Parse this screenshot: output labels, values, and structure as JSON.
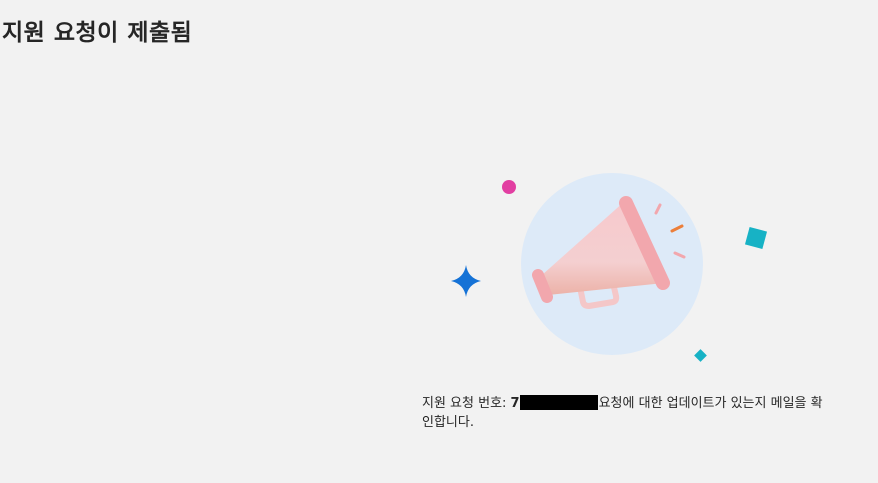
{
  "page": {
    "title": "지원 요청이 제출됨"
  },
  "illustration": {
    "icon": "megaphone-icon",
    "colors": {
      "circle": "#ddeaf8",
      "megaphone": "#f2a7ad",
      "sparkle": "#1572d6",
      "dot": "#e23fa2",
      "diamond": "#17b2c5",
      "accent": "#ec7f3a"
    }
  },
  "confirmation": {
    "ticket_label": "지원 요청 번호:",
    "ticket_number_visible": "7",
    "redacted": true,
    "message": "요청에 대한 업데이트가 있는지 메일을 확인합니다."
  }
}
